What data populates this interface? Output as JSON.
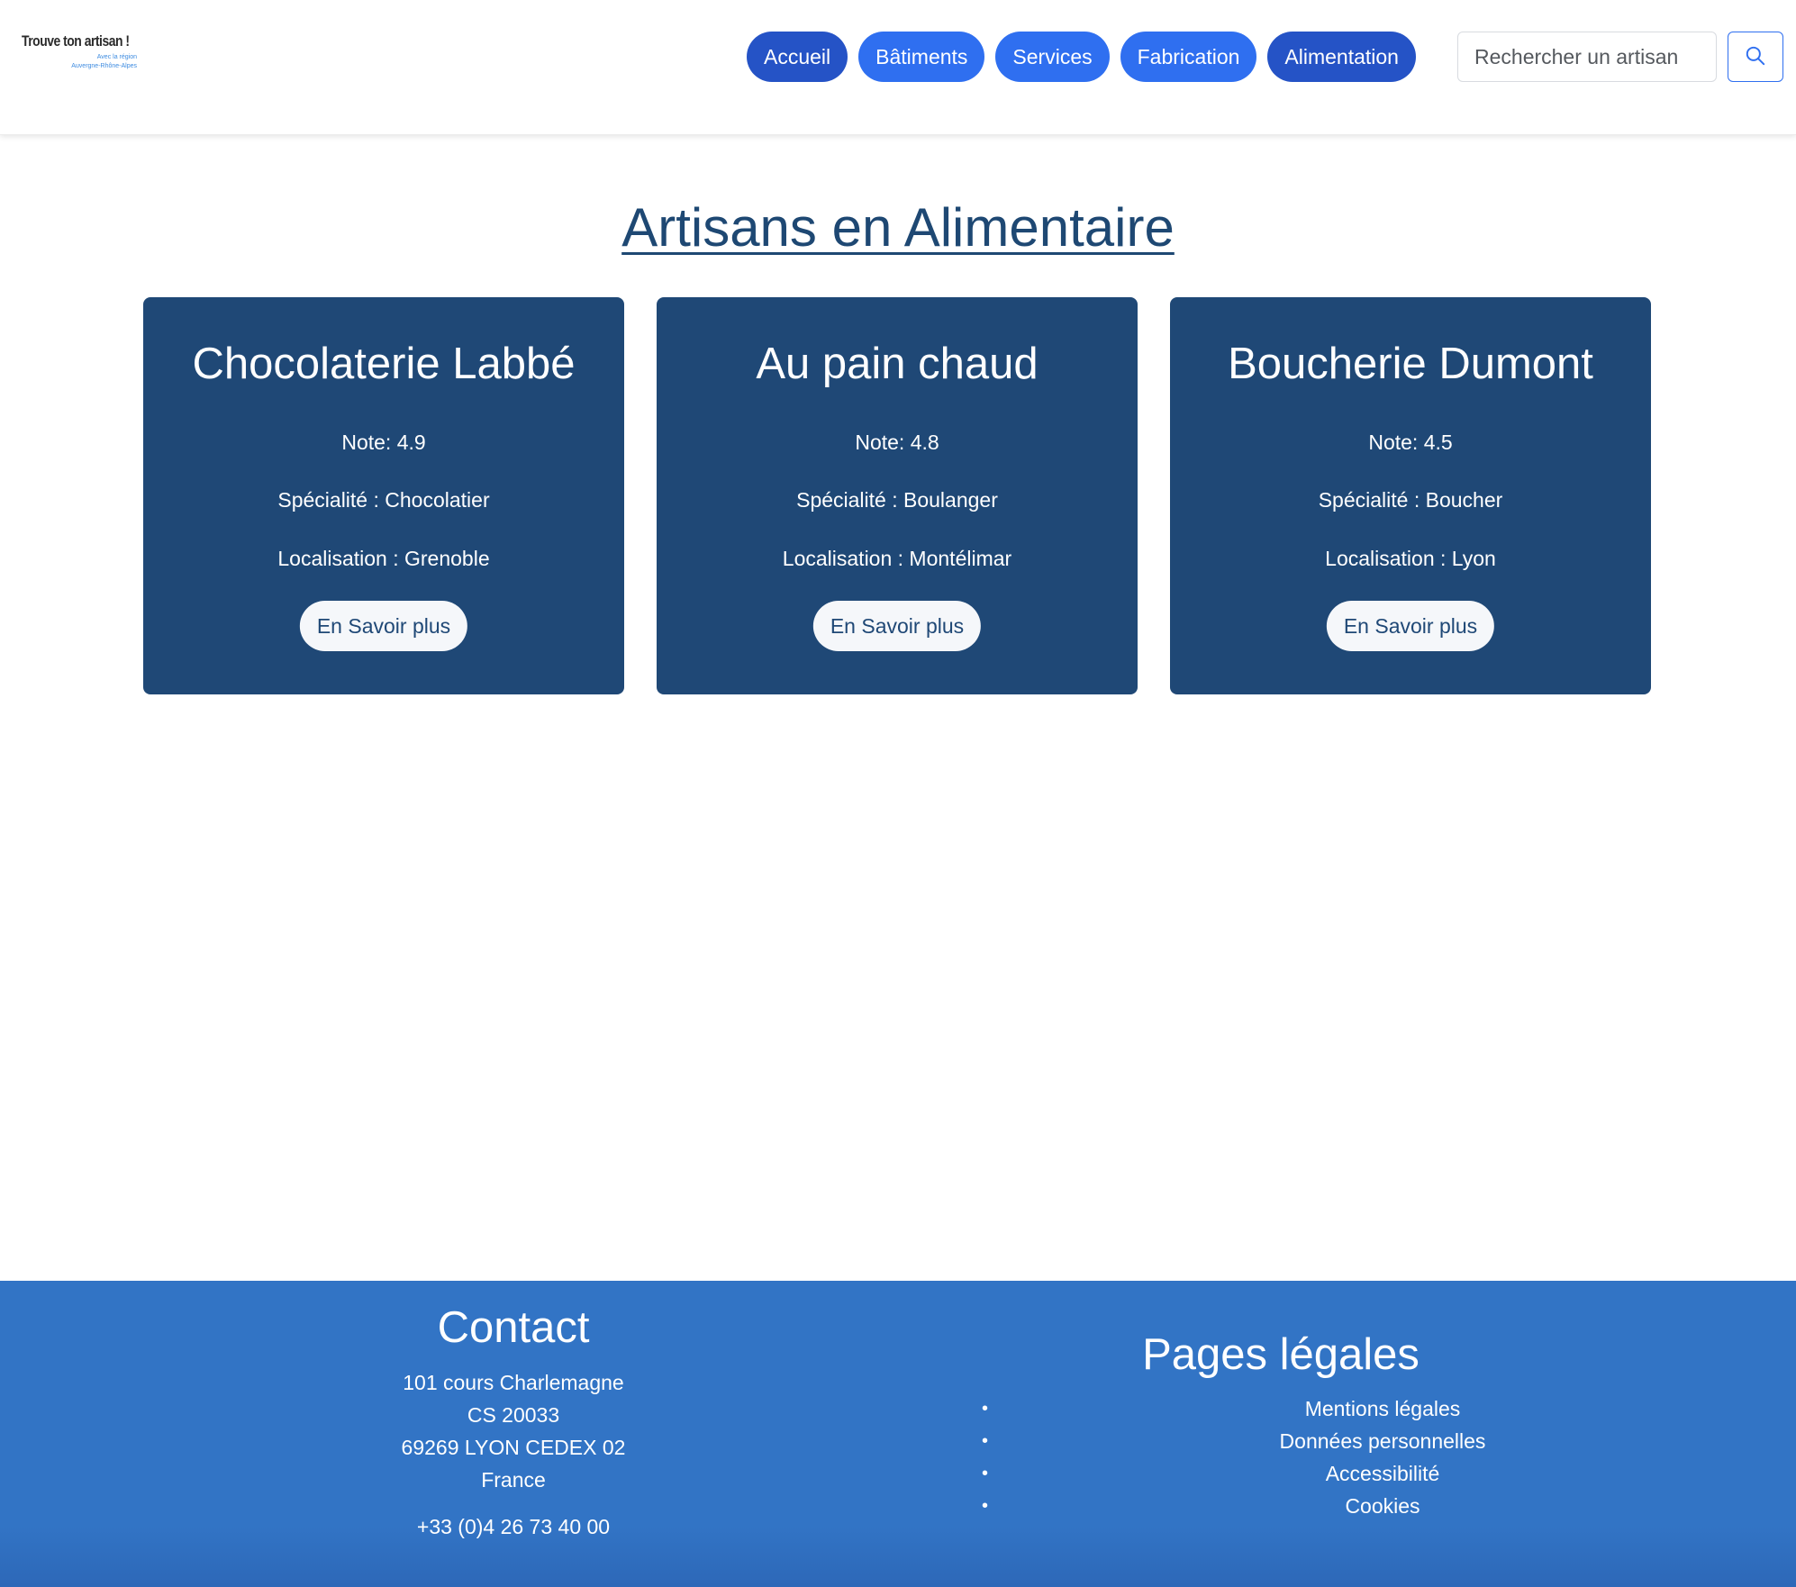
{
  "header": {
    "logo": {
      "title": "Trouve ton artisan !",
      "subtitle_line1": "Avec la région",
      "subtitle_line2": "Auvergne-Rhône-Alpes"
    },
    "nav": [
      {
        "label": "Accueil"
      },
      {
        "label": "Bâtiments"
      },
      {
        "label": "Services"
      },
      {
        "label": "Fabrication"
      },
      {
        "label": "Alimentation"
      }
    ],
    "search": {
      "placeholder": "Rechercher un artisan",
      "button_icon": "search-icon"
    }
  },
  "main": {
    "title": "Artisans en Alimentaire",
    "cards": [
      {
        "name": "Chocolaterie Labbé",
        "note": "Note: 4.9",
        "specialite": "Spécialité : Chocolatier",
        "localisation": "Localisation : Grenoble",
        "button": "En Savoir plus"
      },
      {
        "name": "Au pain chaud",
        "note": "Note: 4.8",
        "specialite": "Spécialité : Boulanger",
        "localisation": "Localisation : Montélimar",
        "button": "En Savoir plus"
      },
      {
        "name": "Boucherie Dumont",
        "note": "Note: 4.5",
        "specialite": "Spécialité : Boucher",
        "localisation": "Localisation : Lyon",
        "button": "En Savoir plus"
      }
    ]
  },
  "footer": {
    "contact": {
      "title": "Contact",
      "address": [
        "101 cours Charlemagne",
        "CS 20033",
        "69269 LYON CEDEX 02",
        "France"
      ],
      "phone": "+33 (0)4 26 73 40 00"
    },
    "legal": {
      "title": "Pages légales",
      "links": [
        "Mentions légales",
        "Données personnelles",
        "Accessibilité",
        "Cookies"
      ]
    }
  },
  "colors": {
    "nav_dark": "#2553c6",
    "nav_light": "#2f6ff0",
    "title": "#1e4873",
    "card_bg": "#1f4876",
    "footer_bg": "#3274c5"
  }
}
